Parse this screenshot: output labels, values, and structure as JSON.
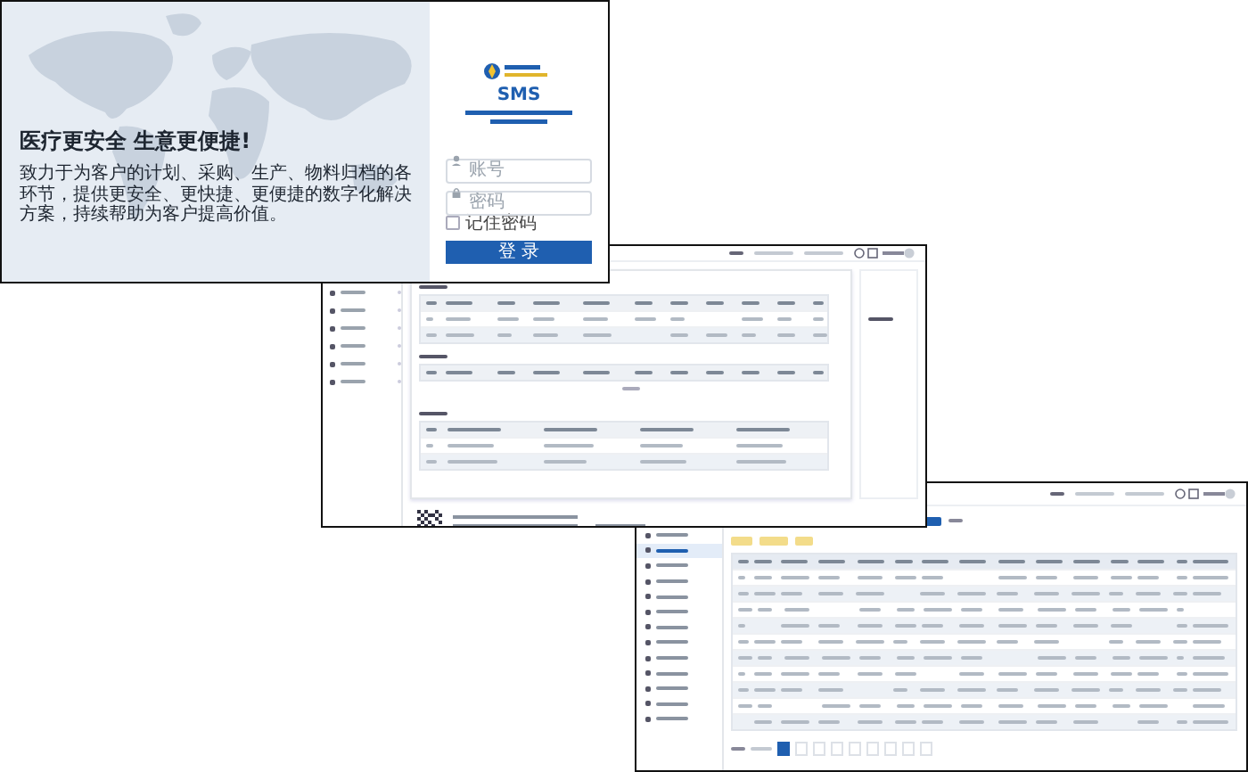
{
  "login_window": {
    "headline": "医疗更安全 生意更便捷!",
    "description": "致力于为客户的计划、采购、生产、物料归档的各环节，提供更安全、更快捷、更便捷的数字化解决方案，持续帮助为客户提高价值。",
    "brand": "SMS",
    "fields": [
      {
        "kind": "user",
        "placeholder": "账号"
      },
      {
        "kind": "lock",
        "placeholder": "密码"
      }
    ],
    "remember": {
      "label": "记住密码",
      "checked": false
    },
    "login_button": "登 录"
  },
  "list_window": {
    "sidebar_items": [
      {
        "selected": false
      },
      {
        "selected": true
      },
      {
        "selected": false
      },
      {
        "selected": false
      },
      {
        "selected": false
      },
      {
        "selected": false
      },
      {
        "selected": false
      },
      {
        "selected": false
      },
      {
        "selected": false
      },
      {
        "selected": false
      },
      {
        "selected": false
      },
      {
        "selected": false
      },
      {
        "selected": false
      }
    ],
    "pages": [
      {
        "selected": true
      },
      {
        "selected": false
      },
      {
        "selected": false
      },
      {
        "selected": false
      },
      {
        "selected": false
      },
      {
        "selected": false
      },
      {
        "selected": false
      },
      {
        "selected": false
      },
      {
        "selected": false
      }
    ]
  }
}
